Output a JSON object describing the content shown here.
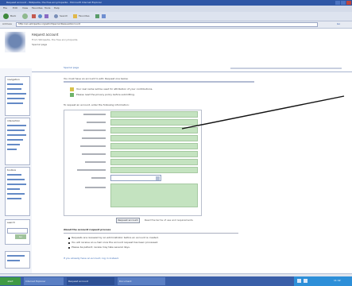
{
  "window": {
    "title": "Request account - Wikipedia, the free encyclopedia - Microsoft Internet Explorer"
  },
  "toolbar": {
    "menu_items": [
      "File",
      "Edit",
      "View",
      "Favorites",
      "Tools",
      "Help"
    ],
    "back_label": "Back",
    "search_label": "Search",
    "favorites_label": "Favorites"
  },
  "address_bar": {
    "label": "Address",
    "value": "http://en.wikipedia.org/wiki/Special:RequestAccount",
    "go_label": "Go"
  },
  "site": {
    "title": "Request account",
    "subtitle": "From Wikipedia, the free encyclopedia",
    "subsubtitle": "Special page"
  },
  "tabs": {
    "special_page": "Special page"
  },
  "sidebar": {
    "navigation_heading": "navigation",
    "navigation": [
      "Main page",
      "Contents",
      "Featured content",
      "Current events",
      "Random article"
    ],
    "interaction_heading": "interaction",
    "interaction": [
      "About Wikipedia",
      "Community portal",
      "Recent changes",
      "Contact Wikipedia",
      "Donate",
      "Help"
    ],
    "toolbox_heading": "toolbox",
    "toolbox": [
      "Upload file",
      "Special pages",
      "Printable version"
    ],
    "search_heading": "search",
    "search_button": "Go"
  },
  "main": {
    "intro": "You must have an account to edit. Request one below.",
    "notice": "Your real name will be used for attribution of your contributions.",
    "notice2": "Please read the privacy policy before submitting.",
    "form_intro": "To request an account, enter the following information:",
    "fields": [
      {
        "label": "Username"
      },
      {
        "label": "Real name"
      },
      {
        "label": "E-mail address"
      },
      {
        "label": "Biography"
      },
      {
        "label": "Areas of interest"
      },
      {
        "label": "Publications"
      },
      {
        "label": "Home page"
      },
      {
        "label": "Confirm e-mail"
      },
      {
        "label": "Country"
      },
      {
        "label": "Comments"
      }
    ],
    "submit_label": "Request account",
    "after_submit": "Read the terms of use and requirements",
    "section_heading": "About the account request process",
    "bullets": [
      "Requests are reviewed by an administrator before an account is created.",
      "You will receive an e-mail once the account request has been processed.",
      "Please be patient; review may take several days."
    ],
    "footer_line": "If you already have an account, log in instead."
  },
  "taskbar": {
    "start_label": "start",
    "items": [
      "Internet Explorer",
      "Request account",
      "Document"
    ],
    "clock": "11:42"
  },
  "colors": {
    "accent": "#3d6db8",
    "field_green": "#c4e3c0",
    "toolbar": "#b9c9e4",
    "taskbar": "#3a5fa8"
  }
}
